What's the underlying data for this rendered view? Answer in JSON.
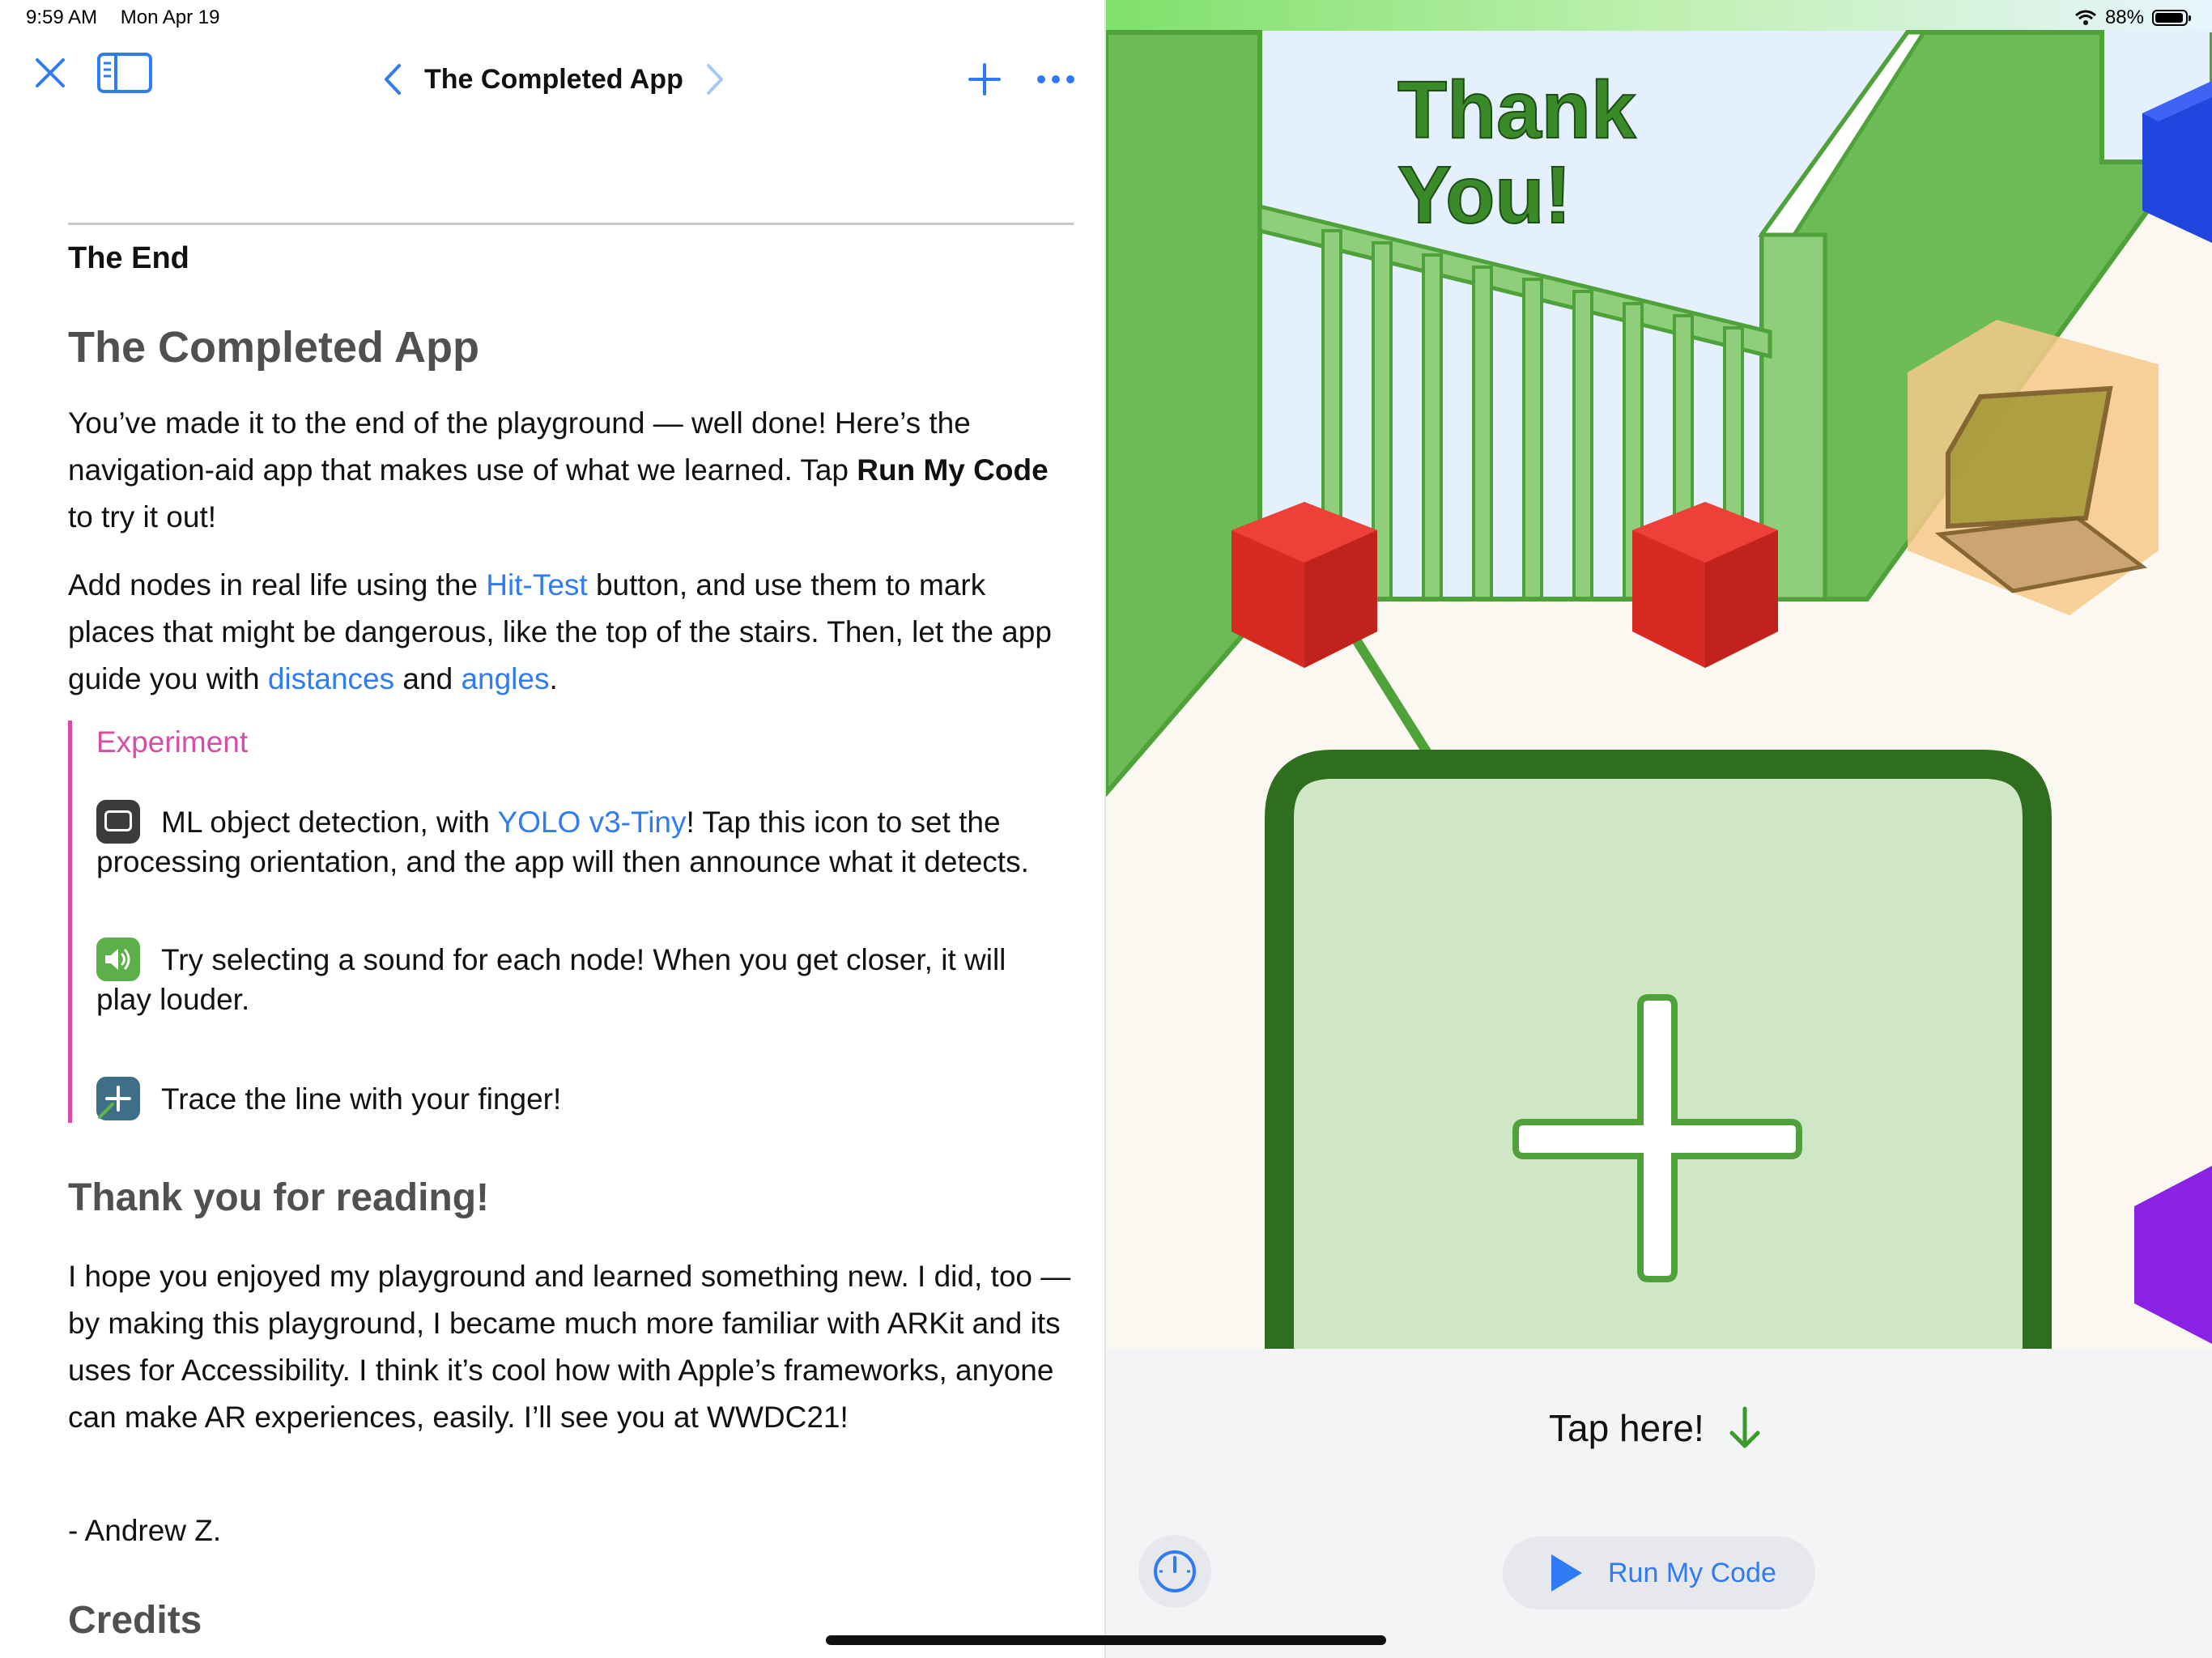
{
  "status_bar": {
    "time": "9:59 AM",
    "date": "Mon Apr 19",
    "battery_percent": "88%"
  },
  "nav": {
    "title": "The Completed App"
  },
  "doc": {
    "section_label": "The End",
    "heading": "The Completed App",
    "p1_a": "You’ve made it to the end of the playground — well done! Here’s the navigation-aid app that makes use of what we learned. Tap ",
    "p1_bold": "Run My Code",
    "p1_b": " to try it out!",
    "p2_a": "Add nodes in real life using the ",
    "p2_link1": "Hit-Test",
    "p2_b": " button, and use them to mark places that might be dangerous, like the top of the stairs. Then, let the app guide you with ",
    "p2_link2": "distances",
    "p2_c": " and ",
    "p2_link3": "angles",
    "p2_d": ".",
    "experiment": {
      "title": "Experiment",
      "item1_a": "ML object detection, with ",
      "item1_link": "YOLO v3-Tiny",
      "item1_b": "! Tap this icon to set the processing orientation, and the app will then announce what it detects.",
      "item2": "Try selecting a sound for each node! When you get closer, it will play louder.",
      "item3": "Trace the line with your finger!"
    },
    "heading2": "Thank you for reading!",
    "p3": "I hope you enjoyed my playground and learned something new. I did, too — by making this playground, I became much more familiar with ARKit and its uses for Accessibility. I think it’s cool how with Apple’s frameworks, anyone can make AR experiences, easily. I’ll see you at WWDC21!",
    "signature": "- Andrew Z.",
    "heading3": "Credits"
  },
  "scene": {
    "thank_you_line1": "Thank",
    "thank_you_line2": "You!"
  },
  "live_view": {
    "tap_here": "Tap here!",
    "run_label": "Run My Code"
  },
  "colors": {
    "accent": "#2f7bf5",
    "experiment": "#d64ca6",
    "green": "#5fb548",
    "dark_green": "#2f6e1f"
  },
  "icons": [
    "close-icon",
    "sidebar-icon",
    "chevron-left-icon",
    "chevron-right-icon",
    "plus-icon",
    "more-icon",
    "orientation-icon",
    "speaker-icon",
    "trace-icon",
    "arrow-down-icon",
    "speedometer-icon",
    "play-icon",
    "wifi-icon",
    "battery-icon"
  ]
}
